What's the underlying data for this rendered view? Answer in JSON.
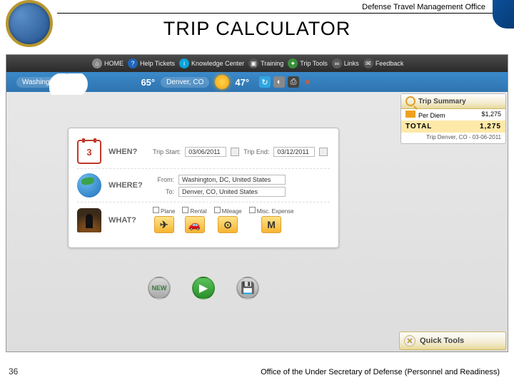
{
  "slide": {
    "header_org": "Defense Travel Management Office",
    "title": "TRIP CALCULATOR",
    "page_number": "36",
    "footer": "Office of the Under Secretary of Defense (Personnel and Readiness)"
  },
  "topnav": {
    "home": "HOME",
    "help": "Help Tickets",
    "knowledge": "Knowledge Center",
    "training": "Training",
    "tools": "Trip Tools",
    "links": "Links",
    "feedback": "Feedback"
  },
  "weather": {
    "city1": "Washington, DC",
    "temp1": "65°",
    "cond1": "Mostly Cloudy",
    "city2": "Denver, CO",
    "temp2": "47°",
    "cond2": "Sunny"
  },
  "form": {
    "when_label": "WHEN?",
    "start_label": "Trip Start:",
    "start_value": "03/06/2011",
    "end_label": "Trip End:",
    "end_value": "03/12/2011",
    "calendar_text": "3",
    "where_label": "WHERE?",
    "from_label": "From:",
    "from_value": "Washington, DC, United States",
    "to_label": "To:",
    "to_value": "Denver, CO, United States",
    "what_label": "WHAT?",
    "what_items": {
      "plane": "Plane",
      "rental": "Rental",
      "mileage": "Mileage",
      "misc": "Misc. Expense"
    },
    "chip_plane": "✈",
    "chip_rental": "🚗",
    "chip_mileage": "⊙",
    "chip_misc": "M"
  },
  "buttons": {
    "new": "NEW",
    "play": "▶",
    "save": "💾"
  },
  "summary": {
    "title": "Trip Summary",
    "perdiem_label": "Per Diem",
    "perdiem_value": "$1,275",
    "total_label": "TOTAL",
    "total_value": "1,275",
    "subtitle": "Trip Denver, CO - 03-06-2011"
  },
  "quick_tools": "Quick Tools"
}
